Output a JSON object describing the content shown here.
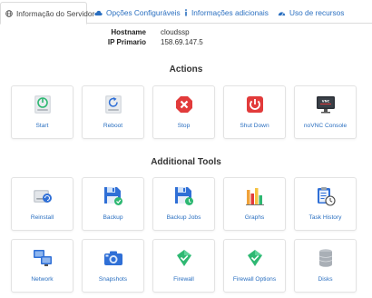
{
  "tabs": [
    {
      "label": "Informação do Servidor",
      "icon": "globe-icon",
      "active": true
    },
    {
      "label": "Opções Configuráveis",
      "icon": "cloud-icon",
      "active": false
    },
    {
      "label": "Informações adicionais",
      "icon": "info-icon",
      "active": false
    },
    {
      "label": "Uso de recursos",
      "icon": "dashboard-icon",
      "active": false
    }
  ],
  "server_info": {
    "hostname_label": "Hostname",
    "hostname_value": "cloudssp",
    "ip_label": "IP Primario",
    "ip_value": "158.69.147.5"
  },
  "actions": {
    "title": "Actions",
    "items": [
      {
        "label": "Start",
        "icon": "power-on-drive-icon"
      },
      {
        "label": "Reboot",
        "icon": "reboot-drive-icon"
      },
      {
        "label": "Stop",
        "icon": "stop-icon"
      },
      {
        "label": "Shut Down",
        "icon": "shutdown-icon"
      },
      {
        "label": "noVNC Console",
        "icon": "vnc-monitor-icon"
      }
    ]
  },
  "tools": {
    "title": "Additional Tools",
    "items": [
      {
        "label": "Reinstall",
        "icon": "reinstall-drive-icon"
      },
      {
        "label": "Backup",
        "icon": "backup-floppy-icon"
      },
      {
        "label": "Backup Jobs",
        "icon": "backup-jobs-floppy-icon"
      },
      {
        "label": "Graphs",
        "icon": "graphs-icon"
      },
      {
        "label": "Task History",
        "icon": "task-history-icon"
      },
      {
        "label": "Network",
        "icon": "network-icon"
      },
      {
        "label": "Snapshots",
        "icon": "snapshots-camera-icon"
      },
      {
        "label": "Firewall",
        "icon": "firewall-shield-icon"
      },
      {
        "label": "Firewall Options",
        "icon": "firewall-options-icon"
      },
      {
        "label": "Disks",
        "icon": "disks-icon"
      }
    ]
  },
  "colors": {
    "link": "#2a6fc0",
    "green": "#2eb872",
    "red": "#e23b3b",
    "blue": "#2f6fd6"
  }
}
